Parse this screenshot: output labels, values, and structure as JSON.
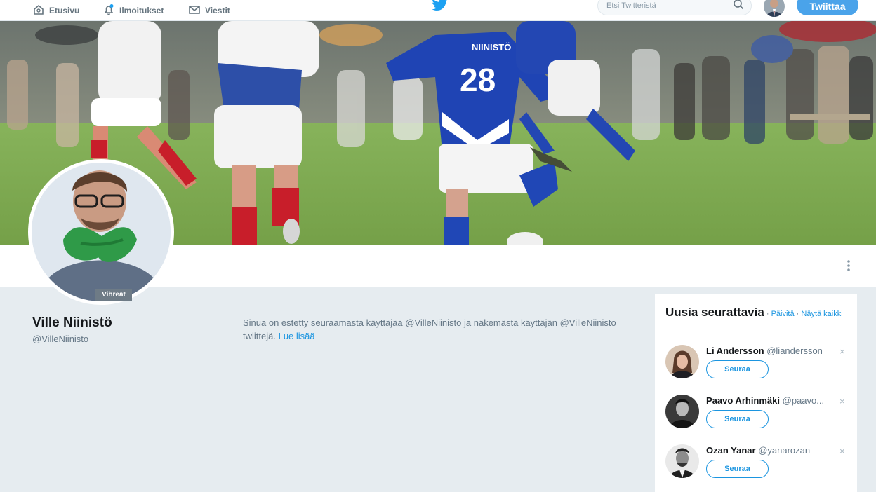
{
  "nav": {
    "home_label": "Etusivu",
    "notifications_label": "Ilmoitukset",
    "messages_label": "Viestit",
    "search_placeholder": "Etsi Twitteristä",
    "tweet_button": "Twiittaa",
    "icons": {
      "home": "home-icon",
      "notifications": "bell-icon",
      "messages": "envelope-icon",
      "logo": "twitter-bird-icon",
      "search": "search-icon"
    },
    "accent_color": "#4aa3ea"
  },
  "banner": {
    "description": "soccer-photo",
    "jersey_text": "NIINISTÖ",
    "jersey_number": "28"
  },
  "profile": {
    "name": "Ville Niinistö",
    "handle": "@VilleNiinisto",
    "avatar_tag": "Vihreät",
    "blocked_text": "Sinua on estetty seuraamasta käyttäjää @VilleNiinisto ja näkemästä käyttäjän @VilleNiinisto twiittejä.",
    "learn_more": "Lue lisää",
    "more_icon": "vertical-ellipsis-icon"
  },
  "who_to_follow": {
    "title": "Uusia seurattavia",
    "separator": " · ",
    "refresh": "Päivitä",
    "view_all": "Näytä kaikki",
    "users": [
      {
        "name": "Li Andersson",
        "handle": "@liandersson",
        "follow": "Seuraa",
        "dismiss": "×"
      },
      {
        "name": "Paavo Arhinmäki",
        "handle": "@paavo...",
        "follow": "Seuraa",
        "dismiss": "×"
      },
      {
        "name": "Ozan Yanar",
        "handle": "@yanarozan",
        "follow": "Seuraa",
        "dismiss": "×"
      }
    ]
  }
}
